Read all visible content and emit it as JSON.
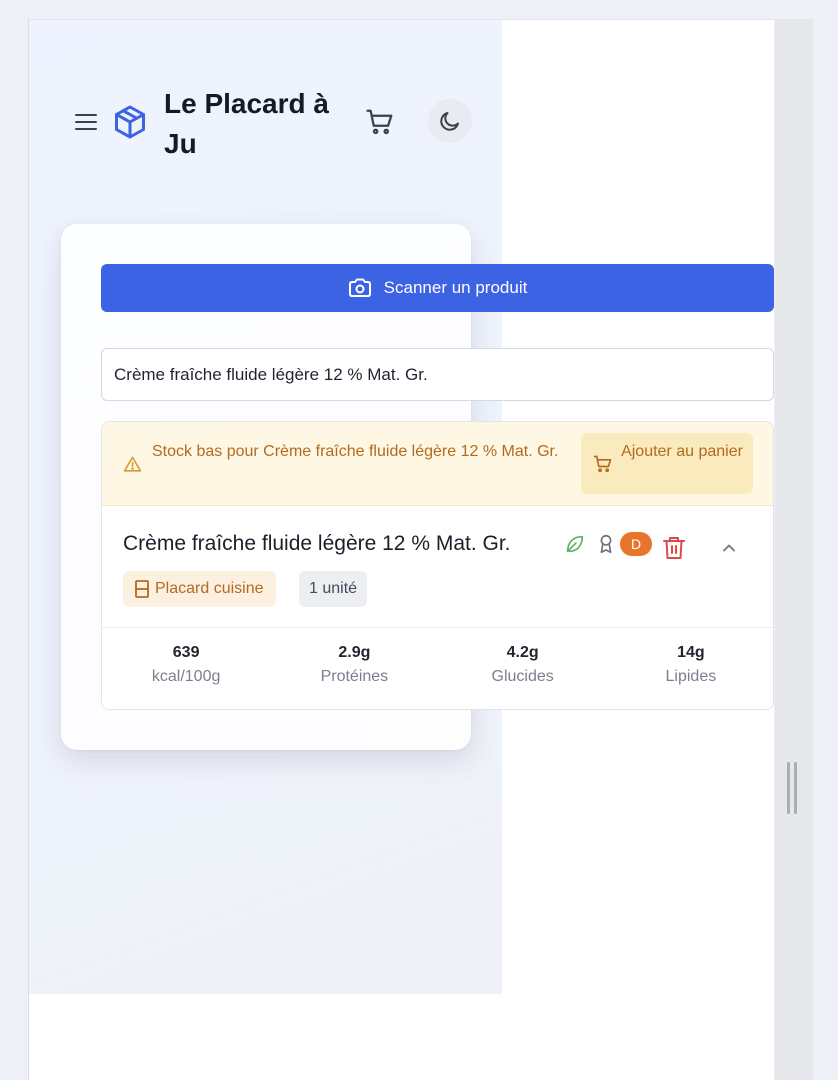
{
  "app": {
    "title": "Le Placard à Ju"
  },
  "header": {
    "menu_icon": "menu-icon",
    "brand_icon": "package-icon",
    "cart_icon": "cart-icon",
    "theme_icon": "moon-icon"
  },
  "scan": {
    "label": "Scanner un produit",
    "icon": "camera-icon"
  },
  "search": {
    "value": "Crème fraîche fluide légère 12 % Mat. Gr."
  },
  "alert": {
    "text": "Stock bas pour Crème fraîche fluide légère 12 % Mat. Gr.",
    "button_label": "Ajouter au panier",
    "color": "#b46a1e"
  },
  "product": {
    "name": "Crème fraîche fluide légère 12 % Mat. Gr.",
    "score": "D",
    "score_color": "#e9742a",
    "location": "Placard cuisine",
    "quantity": "1 unité",
    "nutrition": [
      {
        "value": "639",
        "label": "kcal/100g"
      },
      {
        "value": "2.9g",
        "label": "Protéines"
      },
      {
        "value": "4.2g",
        "label": "Glucides"
      },
      {
        "value": "14g",
        "label": "Lipides"
      }
    ]
  },
  "colors": {
    "accent": "#3c63e3",
    "danger": "#e04848",
    "eco": "#58b368"
  }
}
